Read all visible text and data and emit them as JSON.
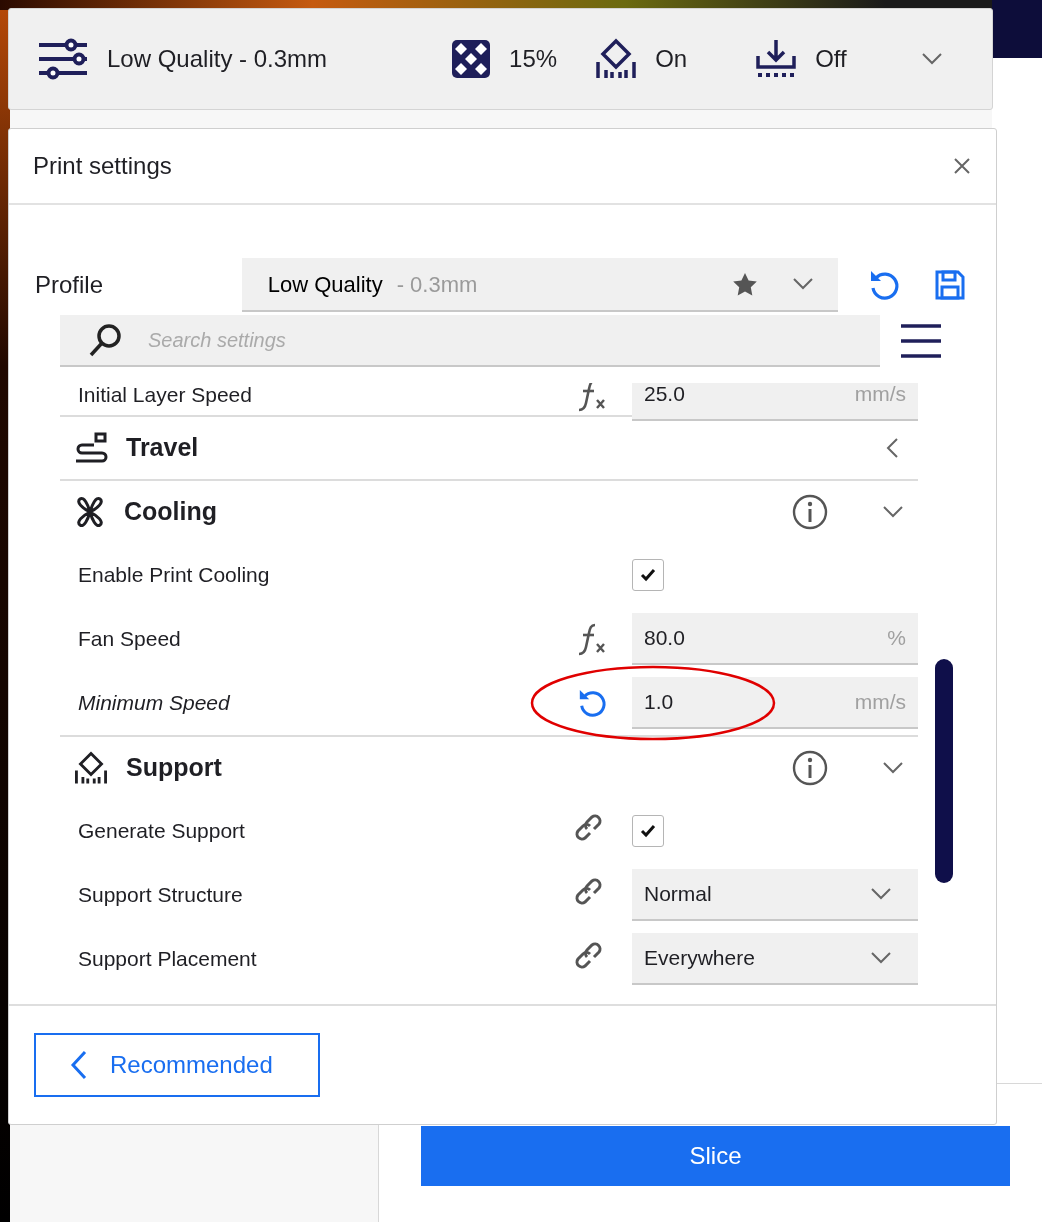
{
  "toolbar": {
    "profile": "Low Quality - 0.3mm",
    "infill": "15%",
    "support": "On",
    "adhesion": "Off"
  },
  "panel": {
    "title": "Print settings",
    "profile_label": "Profile",
    "profile_name": "Low Quality",
    "profile_detail": "- 0.3mm",
    "search_placeholder": "Search settings",
    "settings": [
      {
        "kind": "number",
        "label": "Initial Layer Speed",
        "computed": true,
        "linked": false,
        "value": "25.0",
        "unit": "mm/s",
        "modified": false
      },
      {
        "kind": "category",
        "label": "Travel",
        "expanded": false,
        "info": false
      },
      {
        "kind": "category",
        "label": "Cooling",
        "expanded": true,
        "info": true
      },
      {
        "kind": "checkbox",
        "label": "Enable Print Cooling",
        "computed": false,
        "linked": false,
        "checked": true,
        "modified": false
      },
      {
        "kind": "number",
        "label": "Fan Speed",
        "computed": true,
        "linked": false,
        "value": "80.0",
        "unit": "%",
        "modified": false
      },
      {
        "kind": "number",
        "label": "Minimum Speed",
        "computed": false,
        "linked": false,
        "value": "1.0",
        "unit": "mm/s",
        "modified": true,
        "highlighted": true
      },
      {
        "kind": "category",
        "label": "Support",
        "expanded": true,
        "info": true
      },
      {
        "kind": "checkbox",
        "label": "Generate Support",
        "computed": false,
        "linked": true,
        "checked": true,
        "modified": false
      },
      {
        "kind": "select",
        "label": "Support Structure",
        "computed": false,
        "linked": true,
        "value": "Normal",
        "modified": false
      },
      {
        "kind": "select",
        "label": "Support Placement",
        "computed": false,
        "linked": true,
        "value": "Everywhere",
        "modified": false
      }
    ],
    "footer_button": "Recommended"
  },
  "slice_button": "Slice"
}
